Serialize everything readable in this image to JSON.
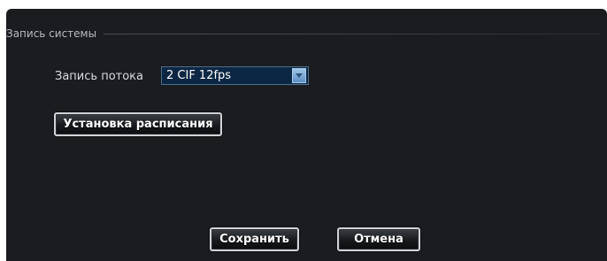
{
  "section": {
    "title": "Запись системы"
  },
  "stream": {
    "label": "Запись потока",
    "selected": "2 CIF 12fps",
    "dropdown_icon": "chevron-down-icon"
  },
  "buttons": {
    "schedule_label": "Установка расписания",
    "save_label": "Сохранить",
    "cancel_label": "Отмена"
  },
  "colors": {
    "panel_background": "#1a1c1f",
    "select_background": "#0c2743",
    "select_arrow": "#7fb0de",
    "button_border": "#cfd3d8"
  }
}
